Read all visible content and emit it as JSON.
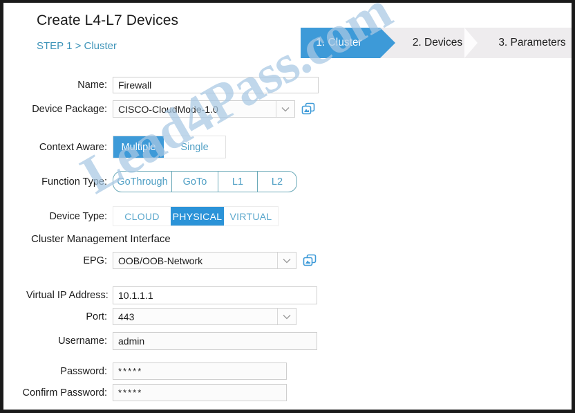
{
  "header": {
    "title": "Create L4-L7 Devices",
    "breadcrumb": "STEP 1 > Cluster"
  },
  "wizard": {
    "steps": [
      {
        "label": "1. Cluster",
        "active": true
      },
      {
        "label": "2. Devices",
        "active": false
      },
      {
        "label": "3. Parameters",
        "active": false
      }
    ]
  },
  "form": {
    "name": {
      "label": "Name:",
      "value": "Firewall"
    },
    "device_package": {
      "label": "Device Package:",
      "value": "CISCO-CloudMode-1.0",
      "link_icon": "open-in-new-icon"
    },
    "context_aware": {
      "label": "Context Aware:",
      "options": [
        "Multiple",
        "Single"
      ],
      "selected": "Multiple"
    },
    "function_type": {
      "label": "Function Type:",
      "options": [
        "GoThrough",
        "GoTo",
        "L1",
        "L2"
      ],
      "selected": ""
    },
    "device_type": {
      "label": "Device Type:",
      "options": [
        "CLOUD",
        "PHYSICAL",
        "VIRTUAL"
      ],
      "selected": "PHYSICAL"
    },
    "section_cluster_mgmt": "Cluster Management Interface",
    "epg": {
      "label": "EPG:",
      "value": "OOB/OOB-Network",
      "link_icon": "open-in-new-icon"
    },
    "virtual_ip": {
      "label": "Virtual IP Address:",
      "value": "10.1.1.1"
    },
    "port": {
      "label": "Port:",
      "value": "443"
    },
    "username": {
      "label": "Username:",
      "value": "admin"
    },
    "password": {
      "label": "Password:",
      "value": "*****"
    },
    "confirm_password": {
      "label": "Confirm Password:",
      "value": "*****"
    }
  },
  "watermark": {
    "text": "Lead4Pass.com",
    "color": "#a9c9e4"
  },
  "colors": {
    "accent_blue": "#3d9ad8",
    "selected_blue": "#2b93d8",
    "link_text": "#3d93b8",
    "wizard_bg": "#eeecee"
  }
}
